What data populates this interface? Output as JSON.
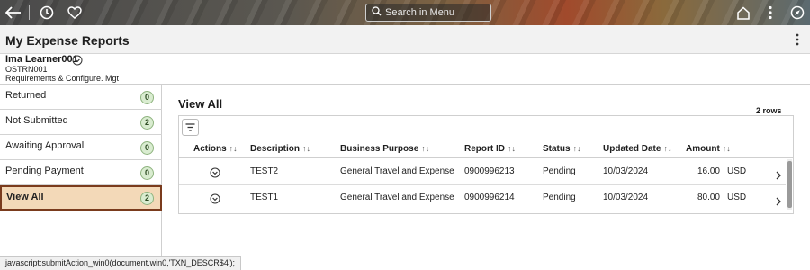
{
  "topbar": {
    "back_icon": "back-arrow-icon",
    "history_icon": "clock-icon",
    "favorites_icon": "heart-icon",
    "search_placeholder": "Search in Menu",
    "home_icon": "home-icon",
    "actions_icon": "kebab-menu-icon",
    "navbar_icon": "compass-icon"
  },
  "page": {
    "title": "My Expense Reports"
  },
  "user": {
    "name": "Ima Learner001",
    "id": "OSTRN001",
    "department": "Requirements & Configure. Mgt"
  },
  "sidebar": {
    "items": [
      {
        "label": "Returned",
        "count": "0"
      },
      {
        "label": "Not Submitted",
        "count": "2"
      },
      {
        "label": "Awaiting Approval",
        "count": "0"
      },
      {
        "label": "Pending Payment",
        "count": "0"
      },
      {
        "label": "View All",
        "count": "2"
      }
    ],
    "active_index": 4
  },
  "main": {
    "title": "View All",
    "row_count": "2 rows"
  },
  "grid": {
    "columns": [
      {
        "label": "Actions"
      },
      {
        "label": "Description"
      },
      {
        "label": "Business Purpose"
      },
      {
        "label": "Report ID"
      },
      {
        "label": "Status"
      },
      {
        "label": "Updated Date"
      },
      {
        "label": "Amount"
      }
    ],
    "rows": [
      {
        "description": "TEST2",
        "business_purpose": "General Travel and Expense",
        "report_id": "0900996213",
        "status": "Pending",
        "updated_date": "10/03/2024",
        "amount": "16.00",
        "currency": "USD"
      },
      {
        "description": "TEST1",
        "business_purpose": "General Travel and Expense",
        "report_id": "0900996214",
        "status": "Pending",
        "updated_date": "10/03/2024",
        "amount": "80.00",
        "currency": "USD"
      }
    ]
  },
  "statusbar": {
    "text": "javascript:submitAction_win0(document.win0,'TXN_DESCR$4');"
  },
  "colors": {
    "active_nav_bg": "#f3d9b8",
    "active_nav_border": "#7a3b1d",
    "badge_bg": "#d9ecd0",
    "badge_border": "#8fb47f"
  }
}
